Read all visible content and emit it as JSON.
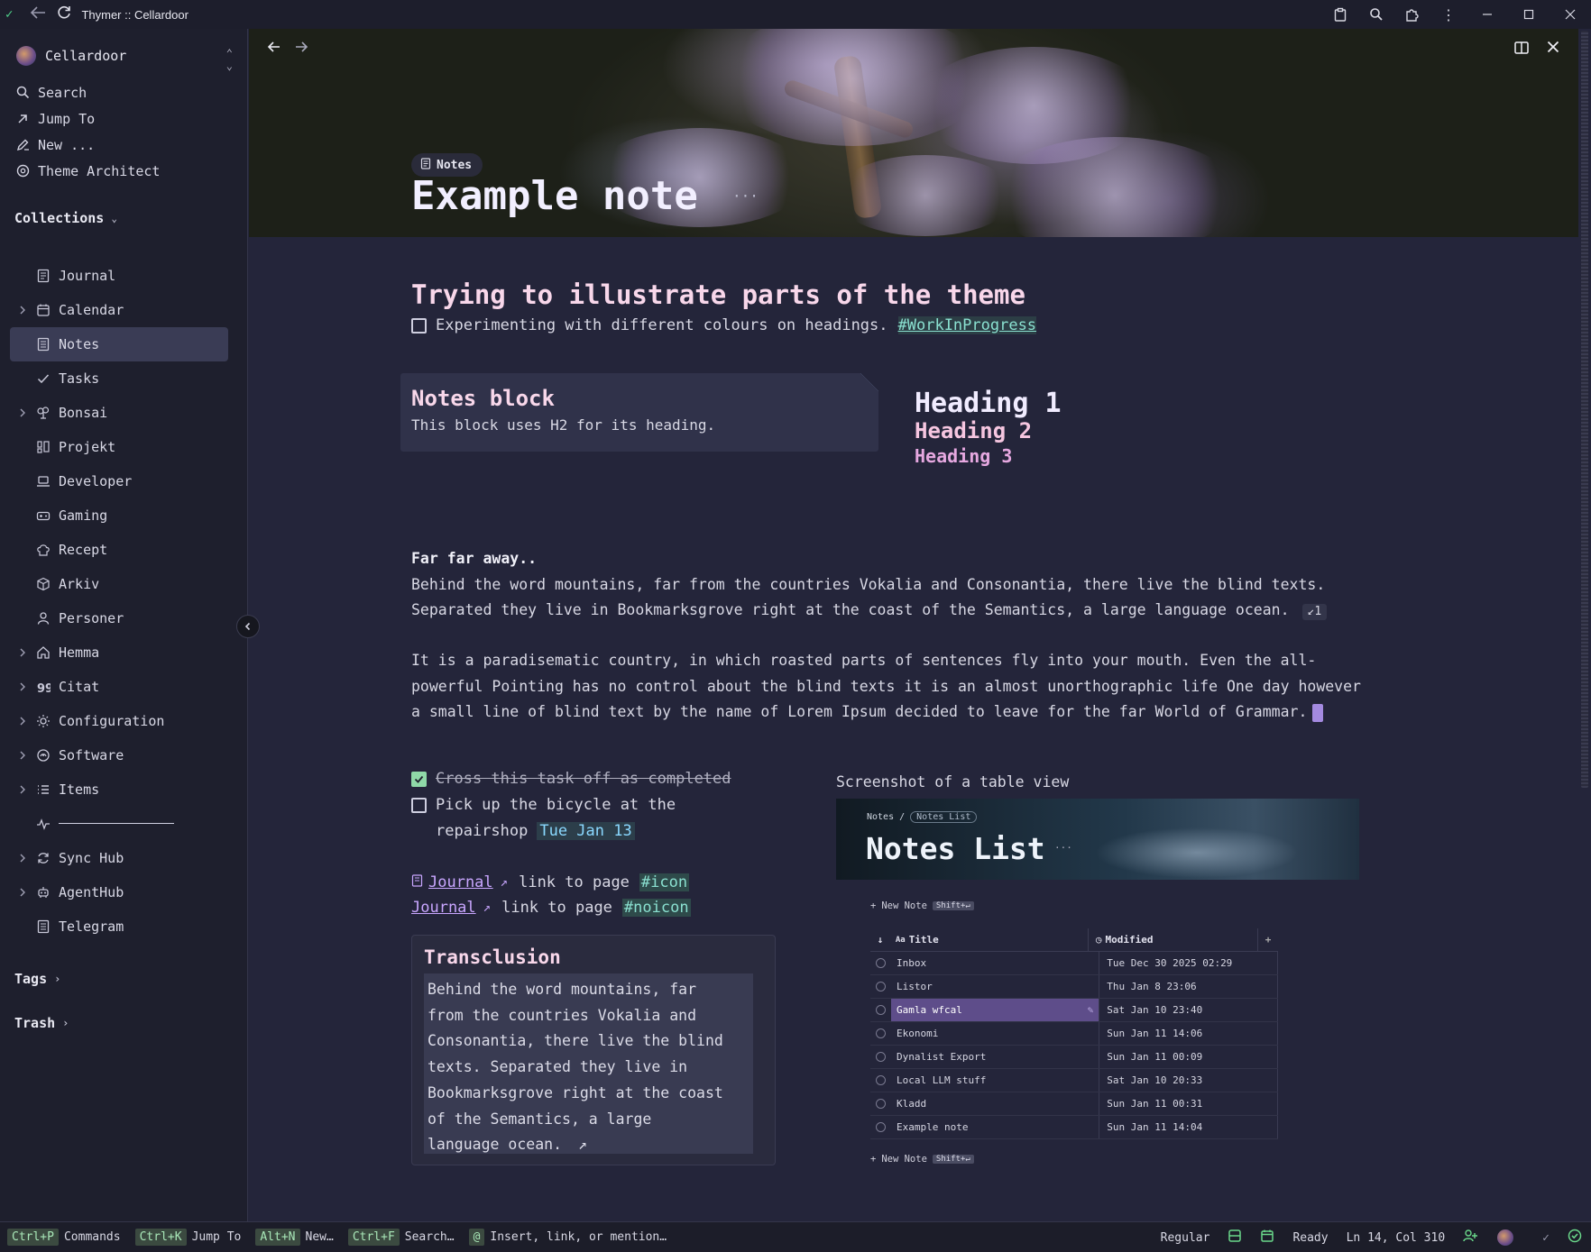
{
  "app": {
    "title": "Thymer :: Cellardoor"
  },
  "sidebar": {
    "workspace": "Cellardoor",
    "quick": [
      {
        "label": "Search",
        "icon": "search-icon"
      },
      {
        "label": "Jump To",
        "icon": "arrow-up-right-icon"
      },
      {
        "label": "New ...",
        "icon": "pen-icon"
      },
      {
        "label": "Theme Architect",
        "icon": "palette-icon"
      }
    ],
    "collections_heading": "Collections",
    "collections": [
      {
        "label": "Journal",
        "icon": "journal-icon",
        "chevron": false
      },
      {
        "label": "Calendar",
        "icon": "calendar-icon",
        "chevron": true
      },
      {
        "label": "Notes",
        "icon": "notes-icon",
        "chevron": false,
        "active": true
      },
      {
        "label": "Tasks",
        "icon": "check-icon",
        "chevron": false
      },
      {
        "label": "Bonsai",
        "icon": "bonsai-icon",
        "chevron": true
      },
      {
        "label": "Projekt",
        "icon": "kanban-icon",
        "chevron": false
      },
      {
        "label": "Developer",
        "icon": "laptop-icon",
        "chevron": false
      },
      {
        "label": "Gaming",
        "icon": "gamepad-icon",
        "chevron": false
      },
      {
        "label": "Recept",
        "icon": "chef-hat-icon",
        "chevron": false
      },
      {
        "label": "Arkiv",
        "icon": "box-icon",
        "chevron": false
      },
      {
        "label": "Personer",
        "icon": "person-icon",
        "chevron": false
      },
      {
        "label": "Hemma",
        "icon": "home-icon",
        "chevron": true
      },
      {
        "label": "Citat",
        "icon": "quote-icon",
        "chevron": true
      },
      {
        "label": "Configuration",
        "icon": "sun-gear-icon",
        "chevron": true
      },
      {
        "label": "Software",
        "icon": "software-icon",
        "chevron": true
      },
      {
        "label": "Items",
        "icon": "list-icon",
        "chevron": true
      },
      {
        "label": "",
        "icon": "pulse-icon",
        "chevron": false,
        "divider": true
      },
      {
        "label": "Sync Hub",
        "icon": "sync-icon",
        "chevron": true
      },
      {
        "label": "AgentHub",
        "icon": "robot-icon",
        "chevron": true
      },
      {
        "label": "Telegram",
        "icon": "telegram-icon",
        "chevron": false
      }
    ],
    "tags_heading": "Tags",
    "trash_heading": "Trash"
  },
  "page": {
    "breadcrumb": "Notes",
    "title": "Example note",
    "heading": "Trying to illustrate parts of the theme",
    "subtask_text": "Experimenting with different colours on headings.",
    "subtask_tag": "#WorkInProgress",
    "notes_block": {
      "heading": "Notes block",
      "text": "This block uses H2 for its heading."
    },
    "headings": {
      "h1": "Heading 1",
      "h2": "Heading 2",
      "h3": "Heading 3"
    },
    "para1_title": "Far far away..",
    "para1_line1": "Behind the word mountains, far from the countries Vokalia and Consonantia, there live the blind texts.",
    "para1_line2": "Separated they live in Bookmarksgrove right at the coast of the Semantics, a large language ocean.",
    "backref": "↙1",
    "para2_line1": "It is a paradisematic country, in which roasted parts of sentences fly into your mouth. Even the all-",
    "para2_line2": "powerful Pointing has no control about the blind texts it is an almost unorthographic life One day however",
    "para2_line3": "a small line of blind text by the name of Lorem Ipsum decided to leave for the far World of Grammar.",
    "task_done": "Cross this task off as completed",
    "task_open_line1": "Pick up the bicycle at the",
    "task_open_line2": "repairshop",
    "task_date": "Tue Jan 13",
    "link1": {
      "text": "Journal",
      "suffix": "link to page",
      "tag": "#icon"
    },
    "link2": {
      "text": "Journal",
      "suffix": "link to page",
      "tag": "#noicon"
    },
    "transclusion": {
      "heading": "Transclusion",
      "lines": [
        "Behind the word mountains, far",
        "from the countries Vokalia and",
        "Consonantia, there live the blind",
        "texts. Separated they live in",
        "Bookmarksgrove right at the coast",
        "of the Semantics, a large",
        "language ocean."
      ]
    },
    "screenshot_label": "Screenshot of a table view"
  },
  "screenshot": {
    "crumb_prefix": "Notes /",
    "crumb_chip": "Notes List",
    "title": "Notes List",
    "new_note": "New Note",
    "new_note_kbd": "Shift+↵",
    "col_title": "Title",
    "col_modified": "Modified",
    "rows": [
      {
        "title": "Inbox",
        "modified": "Tue Dec 30 2025 02:29"
      },
      {
        "title": "Listor",
        "modified": "Thu Jan 8 23:06"
      },
      {
        "title": "Gamla wfcal",
        "modified": "Sat Jan 10 23:40",
        "selected": true
      },
      {
        "title": "Ekonomi",
        "modified": "Sun Jan 11 14:06"
      },
      {
        "title": "Dynalist Export",
        "modified": "Sun Jan 11 00:09"
      },
      {
        "title": "Local LLM stuff",
        "modified": "Sat Jan 10 20:33"
      },
      {
        "title": "Kladd",
        "modified": "Sun Jan 11 00:31"
      },
      {
        "title": "Example note",
        "modified": "Sun Jan 11 14:04"
      }
    ]
  },
  "statusbar": {
    "shortcuts": [
      {
        "kbd": "Ctrl+P",
        "label": "Commands"
      },
      {
        "kbd": "Ctrl+K",
        "label": "Jump To"
      },
      {
        "kbd": "Alt+N",
        "label": "New…"
      },
      {
        "kbd": "Ctrl+F",
        "label": "Search…"
      },
      {
        "kbd": "@",
        "label": "Insert, link, or mention…"
      }
    ],
    "mode": "Regular",
    "status": "Ready",
    "position": "Ln 14, Col 310"
  },
  "colors": {
    "accent": "#8fd9a8",
    "heading_pink": "#f8d7ea",
    "tag": "#8ae0d0",
    "selection": "#5e4d8a"
  }
}
